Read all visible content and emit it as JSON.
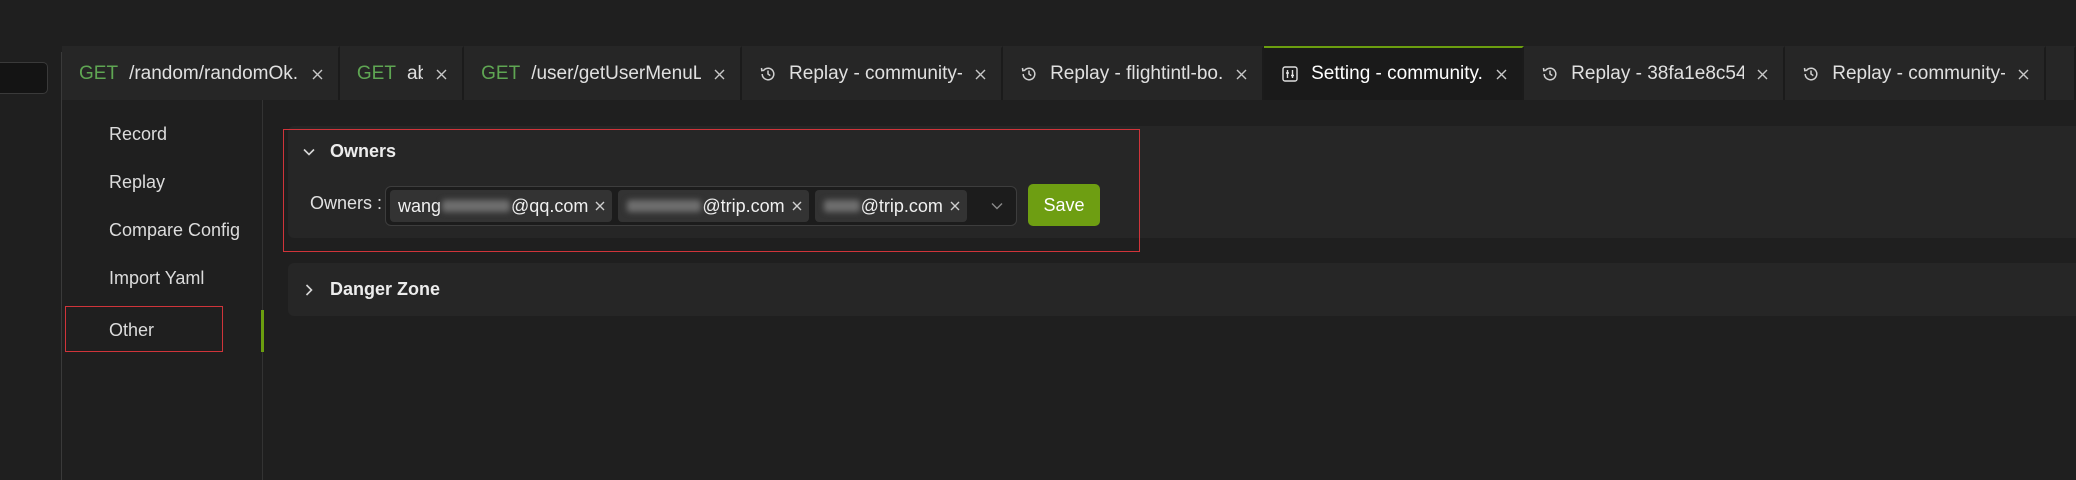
{
  "tabs": [
    {
      "method": "GET",
      "title": "/random/randomOk...",
      "icon": "none",
      "active": false
    },
    {
      "method": "GET",
      "title": "abc",
      "icon": "none",
      "active": false
    },
    {
      "method": "GET",
      "title": "/user/getUserMenuL...",
      "icon": "none",
      "active": false
    },
    {
      "method": "",
      "title": "Replay - community-...",
      "icon": "history-icon",
      "active": false
    },
    {
      "method": "",
      "title": "Replay - flightintl-bo...",
      "icon": "history-icon",
      "active": false
    },
    {
      "method": "",
      "title": "Setting - community...",
      "icon": "settings-sliders-icon",
      "active": true
    },
    {
      "method": "",
      "title": "Replay - 38fa1e8c54...",
      "icon": "history-icon",
      "active": false
    },
    {
      "method": "",
      "title": "Replay - community-...",
      "icon": "history-icon",
      "active": false
    }
  ],
  "sidebar": {
    "items": [
      {
        "label": "Record"
      },
      {
        "label": "Replay"
      },
      {
        "label": "Compare Config"
      },
      {
        "label": "Import Yaml"
      },
      {
        "label": "Other"
      }
    ],
    "active_item": "Other"
  },
  "owners_panel": {
    "title": "Owners",
    "expanded": true,
    "field_label": "Owners :",
    "tags": [
      {
        "prefix": "wang",
        "suffix": "@qq.com"
      },
      {
        "prefix": "",
        "suffix": "@trip.com"
      },
      {
        "prefix": "",
        "suffix": "@trip.com"
      }
    ],
    "save_label": "Save"
  },
  "danger_panel": {
    "title": "Danger Zone",
    "expanded": false
  },
  "colors": {
    "accent": "#6e9e12",
    "method_get": "#5fa653",
    "highlight_outline": "#d0343a",
    "background": "#1f1f1f",
    "panel": "#262626"
  }
}
